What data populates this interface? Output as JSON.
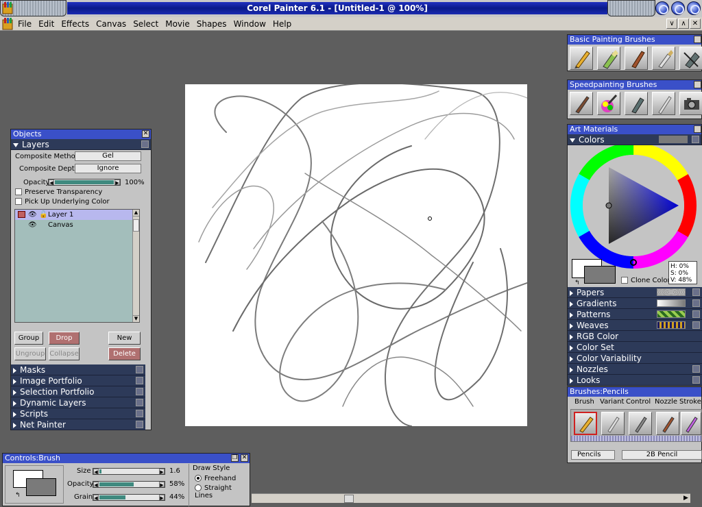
{
  "window": {
    "title": "Corel Painter 6.1 - [Untitled-1 @ 100%]"
  },
  "menu": [
    "File",
    "Edit",
    "Effects",
    "Canvas",
    "Select",
    "Movie",
    "Shapes",
    "Window",
    "Help"
  ],
  "mdi_controls": [
    "∨",
    "∧",
    "✕"
  ],
  "basic_brushes": {
    "title": "Basic Painting Brushes"
  },
  "speed_brushes": {
    "title": "Speedpainting Brushes"
  },
  "objects": {
    "title": "Objects",
    "layers_header": "Layers",
    "composite_method_label": "Composite Method",
    "composite_method_value": "Gel",
    "composite_depth_label": "Composite Depth",
    "composite_depth_value": "Ignore",
    "opacity_label": "Opacity",
    "opacity_value": "100%",
    "opacity_fraction": 1.0,
    "preserve_transparency": "Preserve Transparency",
    "pick_up_underlying": "Pick Up Underlying Color",
    "layers": [
      {
        "name": "Layer 1",
        "selected": true
      },
      {
        "name": "Canvas",
        "selected": false
      }
    ],
    "buttons": {
      "group": "Group",
      "drop": "Drop",
      "new": "New",
      "ungroup": "Ungroup",
      "collapse": "Collapse",
      "delete": "Delete"
    },
    "sections": [
      "Masks",
      "Image Portfolio",
      "Selection Portfolio",
      "Dynamic Layers",
      "Scripts",
      "Net Painter"
    ]
  },
  "art_materials": {
    "title": "Art Materials",
    "colors_header": "Colors",
    "clone_color": "Clone Color",
    "hsv": {
      "h": "H:  0%",
      "s": "S:  0%",
      "v": "V: 48%"
    },
    "sections": [
      "Papers",
      "Gradients",
      "Patterns",
      "Weaves",
      "RGB Color",
      "Color Set",
      "Color Variability",
      "Nozzles",
      "Looks"
    ],
    "primary_color": "#ffffff",
    "secondary_color": "#7a7a7a"
  },
  "brushes": {
    "title": "Brushes:Pencils",
    "menu": [
      "Brush",
      "Variant",
      "Control",
      "Nozzle",
      "Stroke"
    ],
    "category": "Pencils",
    "variant": "2B Pencil"
  },
  "controls": {
    "title": "Controls:Brush",
    "size_label": "Size",
    "size_value": "1.6",
    "size_fraction": 0.03,
    "opacity_label": "Opacity",
    "opacity_value": "58%",
    "opacity_fraction": 0.58,
    "grain_label": "Grain",
    "grain_value": "44%",
    "grain_fraction": 0.44,
    "draw_style_label": "Draw Style",
    "freehand": "Freehand",
    "straight_lines": "Straight Lines"
  }
}
